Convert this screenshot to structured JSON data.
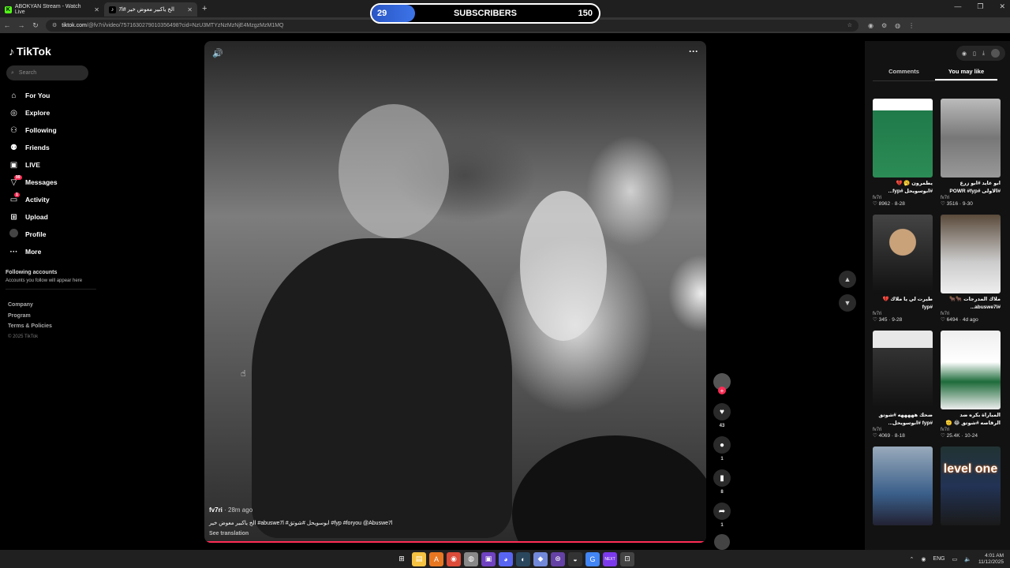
{
  "browser": {
    "tabs": [
      {
        "label": "ABOKYAN Stream - Watch Live",
        "icon": "kick-icon",
        "icon_char": "K",
        "color": "#53fc18",
        "active": false
      },
      {
        "label": "الخ ياكبير معوض خير #abuswe7l",
        "icon": "tiktok-icon",
        "icon_char": "♪",
        "color": "#ffffff",
        "active": true
      }
    ],
    "url_host": "tiktok.com",
    "url_path": "/@fv7ri/video/7571630279010356498?cid=NzU3MTYzNzMzNjE4MzgzMzM1MQ"
  },
  "overlay": {
    "current": "29",
    "label": "SUBSCRIBERS",
    "goal": "150",
    "progress": 0.19
  },
  "sidebar": {
    "logo": "TikTok",
    "search_placeholder": "Search",
    "items": [
      {
        "label": "For You",
        "icon": "home-icon",
        "char": "⌂"
      },
      {
        "label": "Explore",
        "icon": "compass-icon",
        "char": "◎"
      },
      {
        "label": "Following",
        "icon": "following-icon",
        "char": "⚇"
      },
      {
        "label": "Friends",
        "icon": "friends-icon",
        "char": "⚉"
      },
      {
        "label": "LIVE",
        "icon": "live-icon",
        "char": "▣"
      },
      {
        "label": "Messages",
        "icon": "messages-icon",
        "char": "▽",
        "badge": "99"
      },
      {
        "label": "Activity",
        "icon": "activity-icon",
        "char": "▭",
        "badge": "1"
      },
      {
        "label": "Upload",
        "icon": "upload-icon",
        "char": "⊞"
      },
      {
        "label": "Profile",
        "icon": "avatar",
        "char": ""
      },
      {
        "label": "More",
        "icon": "more-icon",
        "char": "···"
      }
    ],
    "following_title": "Following accounts",
    "following_hint": "Accounts you follow will appear here",
    "footer": [
      "Company",
      "Program",
      "Terms & Policies"
    ],
    "copyright": "© 2025 TikTok"
  },
  "video": {
    "author": "fv7ri",
    "time": " · 28m ago",
    "description": "الخ ياكبير معوض خير #abuswe7l #ابوسويحل #شوتق #fyp #foryou @Abuswe7l",
    "see_translation": "See translation",
    "likes": "43",
    "comments": "1",
    "saves": "8",
    "shares": "1"
  },
  "panel": {
    "tabs": [
      "Comments",
      "You may like"
    ],
    "cards": [
      {
        "title": "يطمرون 🥱 💔 #ابوسويحل #fyp...",
        "user": "fv7ri",
        "stats": "♡ 8962 · 8-28",
        "thumb": "t1"
      },
      {
        "title": "ابو عايد #ابو زرع #الاولى #POWR #fyp",
        "user": "fv7ri",
        "stats": "♡ 3516 · 9-30",
        "thumb": "t2"
      },
      {
        "title": "طيرت لي يا ملاك 💔 #fyp #ابوسويحل_التحدي...",
        "user": "fv7ri",
        "stats": "♡ 345 · 9-28",
        "thumb": "t3"
      },
      {
        "title": "ملاك المدرجات 🐂🐂 #abuswe7l...",
        "user": "fv7ri",
        "stats": "♡ 6494 · 4d ago",
        "thumb": "t4"
      },
      {
        "title": "ضحك هههههه #شوتق #fyp #ابوسويحل...",
        "user": "fv7ri",
        "stats": "♡ 4069 · 8-18",
        "thumb": "t5"
      },
      {
        "title": "المباراة بكره ضد الرقاصه #شوتق 😂 🫡",
        "user": "fv7ri",
        "stats": "♡ 25.4K · 10-24",
        "thumb": "t6"
      },
      {
        "title": "",
        "user": "",
        "stats": "",
        "thumb": "t7"
      },
      {
        "title": "",
        "user": "",
        "stats": "",
        "thumb": "t8",
        "overlay": "level one"
      }
    ]
  },
  "taskbar": {
    "apps": [
      "⊞",
      "▤",
      "A",
      "◉",
      "◍",
      "▣",
      "◕",
      "◐",
      "◆",
      "⊛",
      "◒",
      "G",
      "NEXT",
      "⊡"
    ],
    "lang": "ENG",
    "time": "4:01 AM",
    "date": "11/12/2025"
  }
}
